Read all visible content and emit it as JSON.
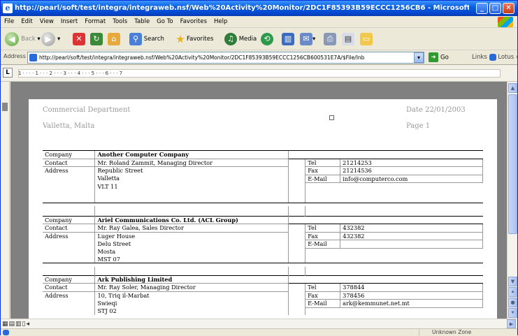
{
  "window": {
    "title": "http://pearl/soft/test/integra/integraweb.nsf/Web%20Activity%20Monitor/2DC1F85393B59ECCC1256CB6 - Microsoft Intern..."
  },
  "menu": [
    "File",
    "Edit",
    "View",
    "Insert",
    "Format",
    "Tools",
    "Table",
    "Go To",
    "Favorites",
    "Help"
  ],
  "toolbar": {
    "back": "Back",
    "search": "Search",
    "favorites": "Favorites",
    "media": "Media"
  },
  "address": {
    "label": "Address",
    "url": "http://pearl/soft/test/integra/integraweb.nsf/Web%20Activity%20Monitor/2DC1F85393B59ECCC1256CB600531E7A/$File/Inb",
    "go": "Go",
    "links": "Links",
    "lotus": "Lotus",
    "more": "»"
  },
  "ruler": "1 · · · · 1 · · · 2 · · · 3 · · · 4 · · · 5 · · · 6 · · · 7",
  "ruler_btn": "L",
  "document": {
    "header_left_1": "Commercial Department",
    "header_left_2": "Valletta, Malta",
    "header_right_1": "Date 22/01/2003",
    "header_right_2": "Page 1",
    "records": [
      {
        "company_label": "Company",
        "company": "Another Computer Company",
        "contact_label": "Contact",
        "contact": "Mr. Roland Zammit, Managing Director",
        "address_label": "Address",
        "address_lines": [
          "Republic Street",
          "Valletta",
          "VLT 11"
        ],
        "tel_label": "Tel",
        "tel": "21214253",
        "fax_label": "Fax",
        "fax": "21214536",
        "email_label": "E-Mail",
        "email": "info@computerco.com"
      },
      {
        "company_label": "Company",
        "company": "Ariel Communications Co. Ltd. (ACL Group)",
        "contact_label": "Contact",
        "contact": "Mr. Ray Galea, Sales Director",
        "address_label": "Address",
        "address_lines": [
          "Luger House",
          "Delu Street",
          "Mosta",
          "MST 07"
        ],
        "tel_label": "Tel",
        "tel": "432382",
        "fax_label": "Fax",
        "fax": "432382",
        "email_label": "E-Mail",
        "email": ""
      },
      {
        "company_label": "Company",
        "company": "Ark Publishing Limited",
        "contact_label": "Contact",
        "contact": "Mr. Ray Soler, Managing Director",
        "address_label": "Address",
        "address_lines": [
          "10, Triq il-Marbat",
          "Swieqi",
          "STJ 02"
        ],
        "tel_label": "Tel",
        "tel": "378844",
        "fax_label": "Fax",
        "fax": "378456",
        "email_label": "E-Mail",
        "email": "ark@kemmunet.net.mt"
      }
    ]
  },
  "status": {
    "zone": "Unknown Zone"
  },
  "colors": {
    "titlebar": "#0a5fe0",
    "chrome": "#ece9d8",
    "docbg": "#808080"
  }
}
